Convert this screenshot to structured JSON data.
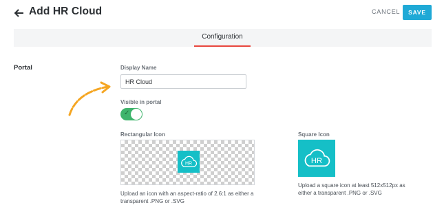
{
  "header": {
    "title": "Add HR Cloud",
    "cancel_label": "CANCEL",
    "save_label": "SAVE"
  },
  "tabs": [
    {
      "label": "Configuration",
      "active": true
    }
  ],
  "section": {
    "label": "Portal"
  },
  "display_name": {
    "label": "Display Name",
    "value": "HR Cloud"
  },
  "visible_in_portal": {
    "label": "Visible in portal",
    "enabled": true
  },
  "rectangular_icon": {
    "label": "Rectangular Icon",
    "help_line1": "Upload an icon with an aspect-ratio of 2.6:1 as either a",
    "help_line2": "transparent .PNG or .SVG",
    "logo_text": "HR"
  },
  "square_icon": {
    "label": "Square Icon",
    "help_line1": "Upload a square icon at least 512x512px as",
    "help_line2": "either a transparent .PNG or .SVG",
    "logo_text": "HR"
  },
  "colors": {
    "accent": "#1fa9d6",
    "tab_underline": "#e8453c",
    "toggle_on": "#3fb46c",
    "logo_bg": "#15bfc7",
    "annotation": "#f5a623"
  }
}
